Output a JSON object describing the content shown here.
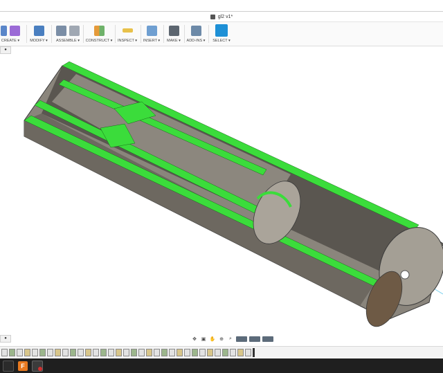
{
  "title": {
    "document": "gl2 v1*"
  },
  "toolbar": {
    "groups": [
      {
        "id": "create",
        "label": "CREATE ▾"
      },
      {
        "id": "modify",
        "label": "MODIFY ▾"
      },
      {
        "id": "assemble",
        "label": "ASSEMBLE ▾"
      },
      {
        "id": "construct",
        "label": "CONSTRUCT ▾"
      },
      {
        "id": "inspect",
        "label": "INSPECT ▾"
      },
      {
        "id": "insert",
        "label": "INSERT ▾"
      },
      {
        "id": "make",
        "label": "MAKE ▾"
      },
      {
        "id": "addins",
        "label": "ADD-INS ▾"
      },
      {
        "id": "select",
        "label": "SELECT ▾"
      }
    ]
  },
  "colors": {
    "accent": "#1e90d6",
    "section_green": "#3bdc3b",
    "body_gray": "#7a756c"
  },
  "nav": {
    "items": [
      "orbit-icon",
      "look-at-icon",
      "pan-icon",
      "zoom-icon",
      "fit-icon",
      "display-settings-icon",
      "grid-icon",
      "viewports-icon"
    ]
  }
}
